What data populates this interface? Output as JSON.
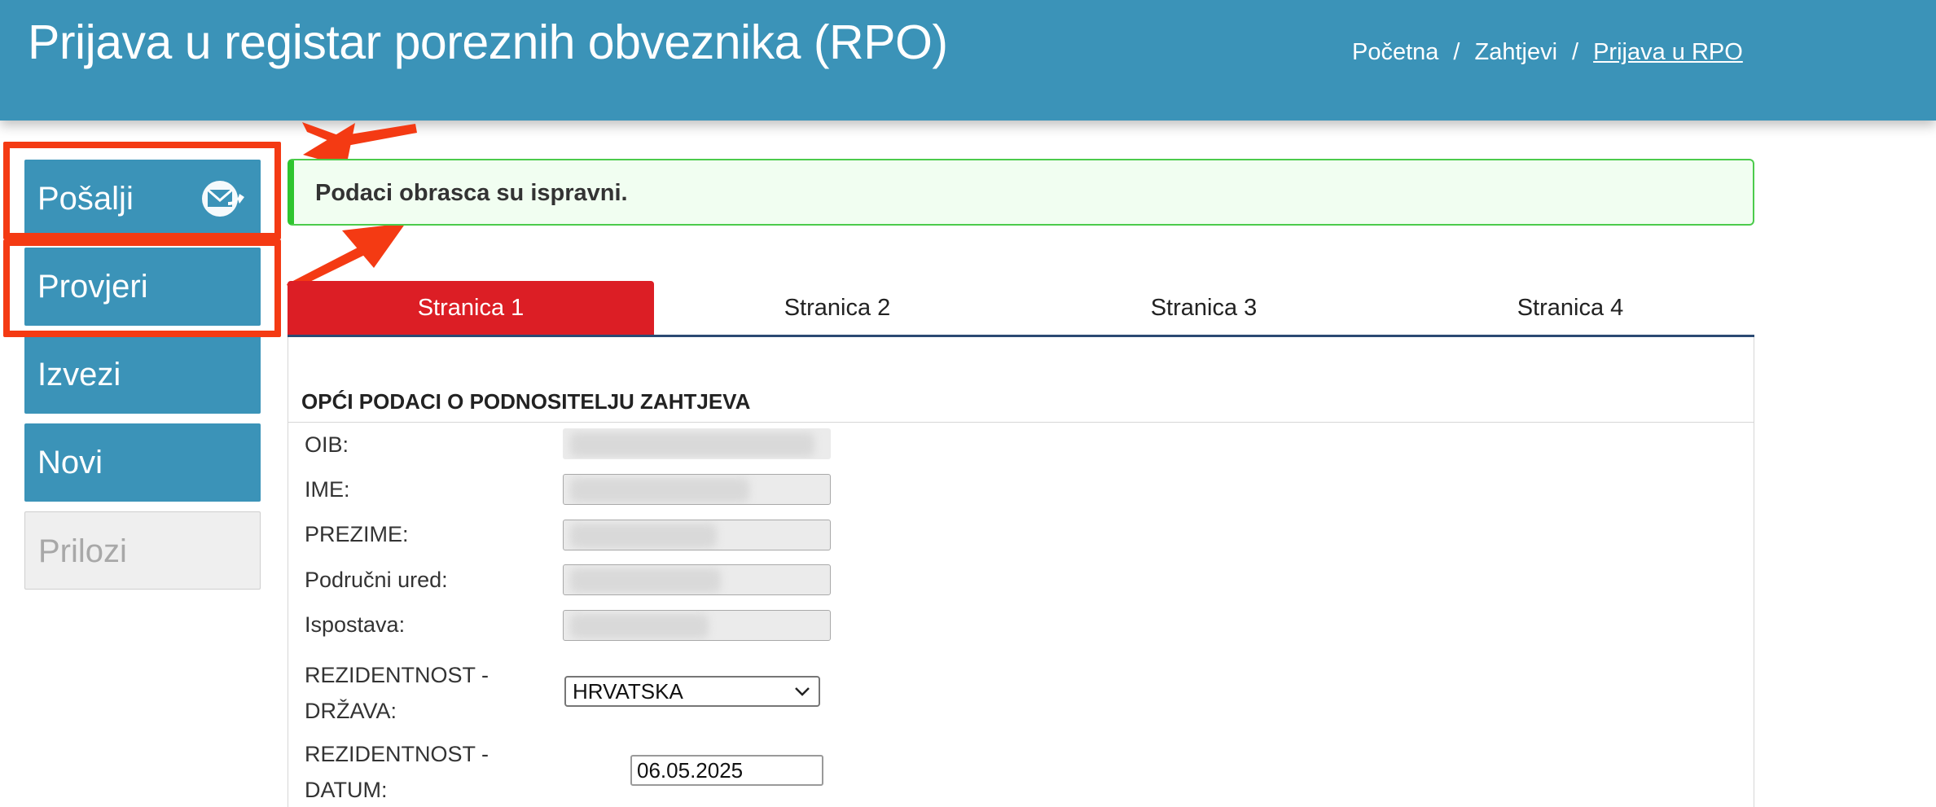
{
  "header": {
    "title": "Prijava u registar poreznih obveznika (RPO)",
    "breadcrumb": [
      "Početna",
      "Zahtjevi",
      "Prijava u RPO"
    ]
  },
  "sidebar": {
    "buttons": [
      {
        "label": "Pošalji",
        "icon": "send-mail-icon"
      },
      {
        "label": "Provjeri"
      },
      {
        "label": "Izvezi"
      },
      {
        "label": "Novi"
      },
      {
        "label": "Prilozi",
        "disabled": true
      }
    ]
  },
  "alert": {
    "message": "Podaci obrasca su ispravni."
  },
  "tabs": [
    "Stranica 1",
    "Stranica 2",
    "Stranica 3",
    "Stranica 4"
  ],
  "form": {
    "section_title": "OPĆI PODACI O PODNOSITELJU ZAHTJEVA",
    "labels": {
      "oib": "OIB:",
      "ime": "IME:",
      "prezime": "PREZIME:",
      "podrucni_ured": "Područni ured:",
      "ispostava": "Ispostava:",
      "rezidentnost_drzava_1": "REZIDENTNOST -",
      "rezidentnost_drzava_2": "DRŽAVA:",
      "rezidentnost_datum_1": "REZIDENTNOST -",
      "rezidentnost_datum_2": "DATUM:"
    },
    "drzava_value": "HRVATSKA",
    "datum_value": "06.05.2025"
  },
  "colors": {
    "header_bg": "#3b93b8",
    "active_tab": "#dc1e25",
    "annotation": "#f43a13",
    "success_border": "#2fc52f"
  }
}
